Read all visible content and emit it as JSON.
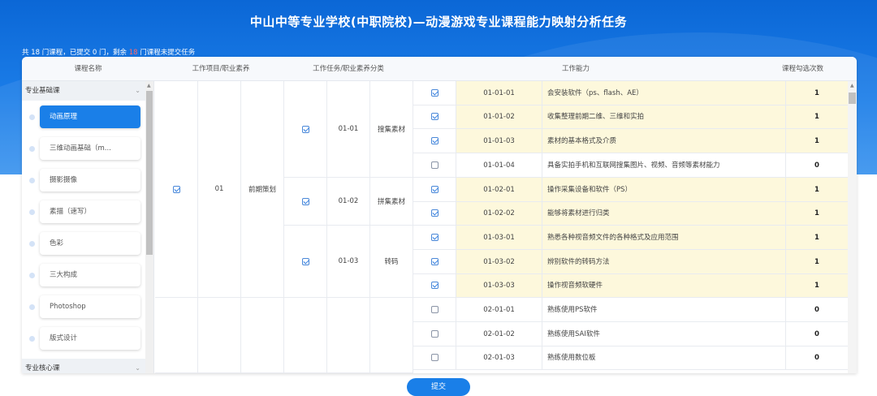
{
  "header": {
    "title": "中山中等专业学校(中职院校)—动漫游戏专业课程能力映射分析任务",
    "summary_prefix": "共 18 门课程，已提交 0 门，剩余 ",
    "summary_remaining": "18",
    "summary_suffix": " 门课程未提交任务"
  },
  "table_headers": {
    "course_name": "课程名称",
    "work_item": "工作项目/职业素养",
    "work_task": "工作任务/职业素养分类",
    "ability": "工作能力",
    "count": "课程勾选次数"
  },
  "sidebar": {
    "group1": "专业基础课",
    "group2": "专业核心课",
    "courses": [
      {
        "label": "动画原理",
        "active": true
      },
      {
        "label": "三维动画基础（m...",
        "active": false
      },
      {
        "label": "摄影摄像",
        "active": false
      },
      {
        "label": "素描（速写）",
        "active": false
      },
      {
        "label": "色彩",
        "active": false
      },
      {
        "label": "三大构成",
        "active": false
      },
      {
        "label": "Photoshop",
        "active": false
      },
      {
        "label": "版式设计",
        "active": false
      }
    ]
  },
  "project": {
    "checked": true,
    "code": "01",
    "name": "前期策划"
  },
  "tasks": [
    {
      "checked": true,
      "code": "01-01",
      "name": "搜集素材"
    },
    {
      "checked": true,
      "code": "01-02",
      "name": "拼集素材"
    },
    {
      "checked": true,
      "code": "01-03",
      "name": "转码"
    }
  ],
  "abilities": [
    {
      "checked": true,
      "code": "01-01-01",
      "text": "会安装软件（ps、flash、AE）",
      "count": "1"
    },
    {
      "checked": true,
      "code": "01-01-02",
      "text": "收集整理前期二维、三维和实拍",
      "count": "1"
    },
    {
      "checked": true,
      "code": "01-01-03",
      "text": "素材的基本格式及介质",
      "count": "1"
    },
    {
      "checked": false,
      "code": "01-01-04",
      "text": "具备实拍手机和互联网搜集图片、视频、音频等素材能力",
      "count": "0"
    },
    {
      "checked": true,
      "code": "01-02-01",
      "text": "操作采集设备和软件（PS）",
      "count": "1"
    },
    {
      "checked": true,
      "code": "01-02-02",
      "text": "能够将素材进行归类",
      "count": "1"
    },
    {
      "checked": true,
      "code": "01-03-01",
      "text": "熟悉各种视音频文件的各种格式及应用范围",
      "count": "1"
    },
    {
      "checked": true,
      "code": "01-03-02",
      "text": "辨别软件的转码方法",
      "count": "1"
    },
    {
      "checked": true,
      "code": "01-03-03",
      "text": "操作视音频软硬件",
      "count": "1"
    },
    {
      "checked": false,
      "code": "02-01-01",
      "text": "熟练使用PS软件",
      "count": "0"
    },
    {
      "checked": false,
      "code": "02-01-02",
      "text": "熟练使用SAI软件",
      "count": "0"
    },
    {
      "checked": false,
      "code": "02-01-03",
      "text": "熟练使用数位板",
      "count": "0"
    }
  ],
  "submit_label": "提交"
}
